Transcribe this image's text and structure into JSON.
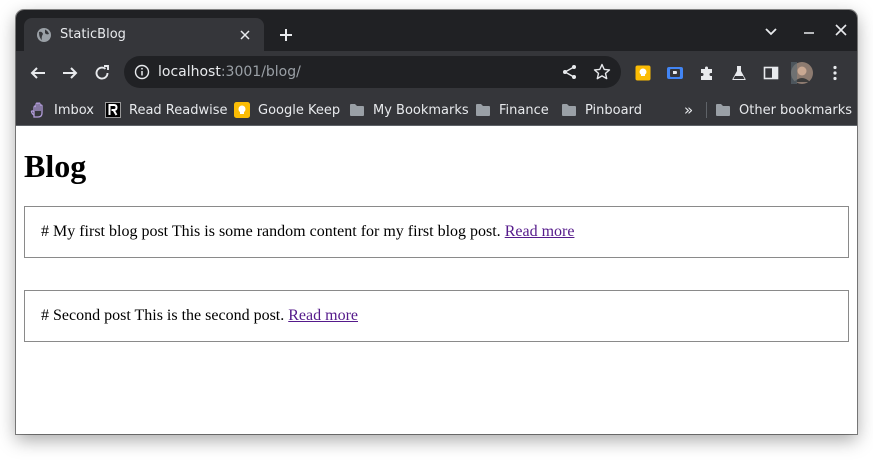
{
  "browser": {
    "tab_title": "StaticBlog",
    "url_host": "localhost",
    "url_path": ":3001/blog/"
  },
  "bookmarks": [
    {
      "label": "Imbox",
      "icon": "hey-imbox-icon"
    },
    {
      "label": "Read Readwise",
      "icon": "readwise-icon"
    },
    {
      "label": "Google Keep",
      "icon": "google-keep-icon"
    },
    {
      "label": "My Bookmarks",
      "icon": "folder-icon"
    },
    {
      "label": "Finance",
      "icon": "folder-icon"
    },
    {
      "label": "Pinboard",
      "icon": "folder-icon"
    }
  ],
  "bookmarks_overflow": "»",
  "other_bookmarks": "Other bookmarks",
  "page": {
    "title": "Blog",
    "posts": [
      {
        "text": "# My first blog post This is some random content for my first blog post.",
        "link": "Read more"
      },
      {
        "text": "# Second post This is the second post.",
        "link": "Read more"
      }
    ]
  },
  "colors": {
    "tabstrip": "#202124",
    "toolbar": "#35363a",
    "link_visited": "#551a8b",
    "keep_yellow": "#fbbc04"
  }
}
